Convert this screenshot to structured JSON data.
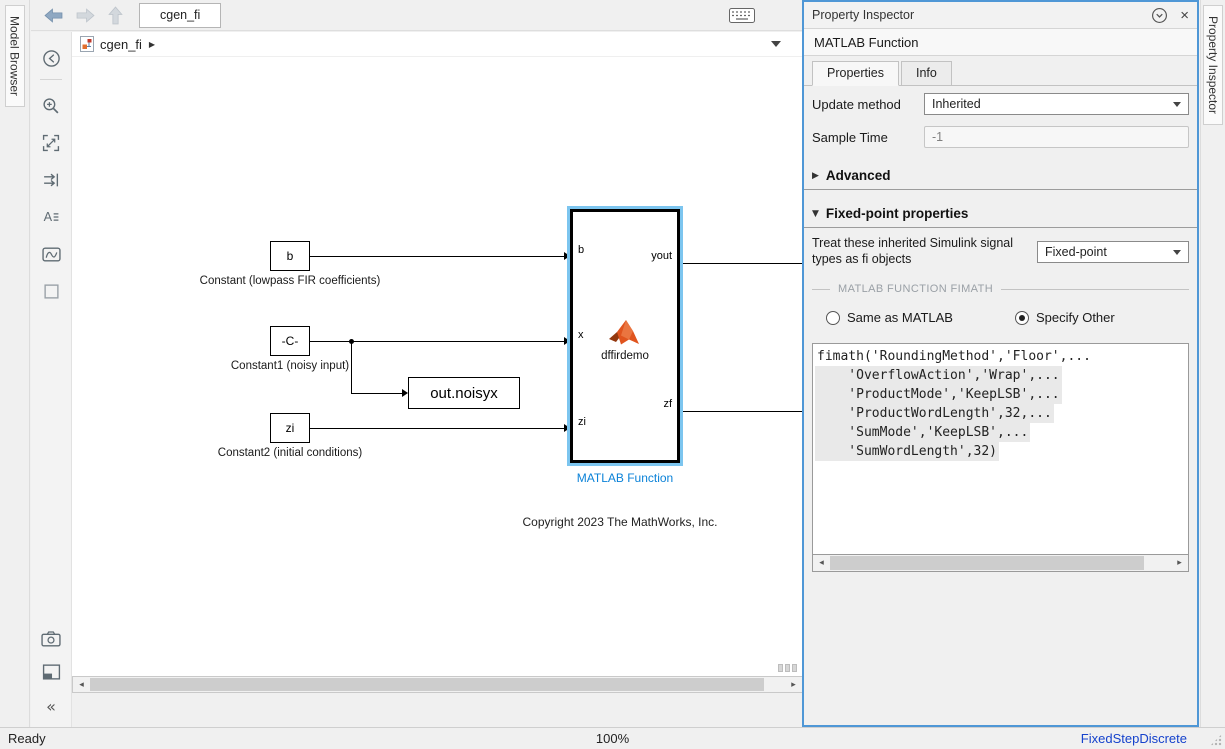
{
  "window": {
    "left_strip_label": "Model Browser",
    "right_strip_label": "Property Inspector"
  },
  "toolbar": {
    "tab_label": "cgen_fi"
  },
  "breadcrumb": {
    "model_name": "cgen_fi"
  },
  "canvas": {
    "blocks": {
      "const_b": {
        "text": "b",
        "caption": "Constant (lowpass FIR coefficients)"
      },
      "const_noisy": {
        "text": "-C-",
        "caption": "Constant1 (noisy input)"
      },
      "const_zi": {
        "text": "zi",
        "caption": "Constant2 (initial conditions)"
      },
      "to_workspace": {
        "text": "out.noisyx"
      },
      "matlab_function": {
        "port_in_1": "b",
        "port_in_2": "x",
        "port_in_3": "zi",
        "port_out_1": "yout",
        "port_out_2": "zf",
        "function_name": "dffirdemo",
        "caption": "MATLAB Function"
      }
    },
    "annotation": "Copyright 2023 The MathWorks, Inc."
  },
  "inspector": {
    "title": "Property Inspector",
    "object_name": "MATLAB Function",
    "tab_properties": "Properties",
    "tab_info": "Info",
    "update_method_label": "Update method",
    "update_method_value": "Inherited",
    "sample_time_label": "Sample Time",
    "sample_time_value": "-1",
    "advanced_section": "Advanced",
    "fixed_point_section": "Fixed-point properties",
    "fi_label": "Treat these inherited Simulink signal types as fi objects",
    "fi_value": "Fixed-point",
    "fimath_group_label": "MATLAB FUNCTION FIMATH",
    "radio_same_label": "Same as MATLAB",
    "radio_specify_label": "Specify Other",
    "fimath_code_lines": [
      "fimath('RoundingMethod','Floor',...",
      "    'OverflowAction','Wrap',...",
      "    'ProductMode','KeepLSB',...",
      "    'ProductWordLength',32,...",
      "    'SumMode','KeepLSB',...",
      "    'SumWordLength',32)"
    ]
  },
  "status": {
    "left": "Ready",
    "zoom": "100%",
    "solver": "FixedStepDiscrete"
  },
  "colors": {
    "selection_blue": "#7cc5ef",
    "panel_focus_border": "#4f97d6",
    "matlab_function_label": "#0b82d8",
    "solver_link": "#1542cc",
    "matlab_logo_orange": "#e0541e"
  }
}
